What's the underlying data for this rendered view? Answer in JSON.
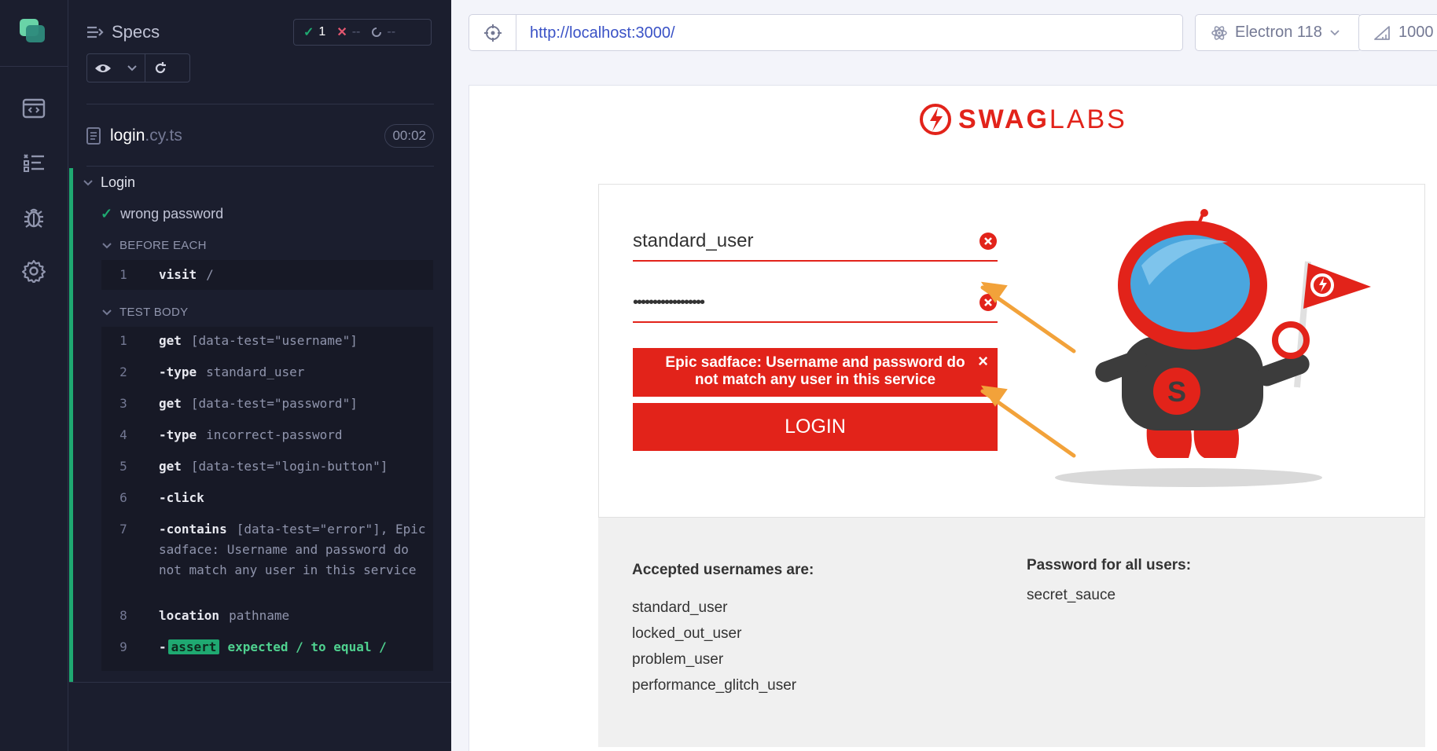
{
  "reporter": {
    "header_title": "Specs",
    "stats": {
      "passed": "1",
      "failed": "--",
      "pending": "--"
    },
    "spec_file": {
      "name": "login",
      "ext": ".cy.ts",
      "duration": "00:02"
    },
    "suite_title": "Login",
    "test_title": "wrong password",
    "before_each_label": "BEFORE EACH",
    "test_body_label": "TEST BODY",
    "before_each_commands": [
      {
        "num": "1",
        "name": "visit",
        "arg": "/"
      }
    ],
    "test_body_commands": [
      {
        "num": "1",
        "name": "get",
        "arg": "[data-test=\"username\"]"
      },
      {
        "num": "2",
        "name": "-type",
        "arg": "standard_user"
      },
      {
        "num": "3",
        "name": "get",
        "arg": "[data-test=\"password\"]"
      },
      {
        "num": "4",
        "name": "-type",
        "arg": "incorrect-password"
      },
      {
        "num": "5",
        "name": "get",
        "arg": "[data-test=\"login-button\"]"
      },
      {
        "num": "6",
        "name": "-click",
        "arg": ""
      },
      {
        "num": "7",
        "name": "-contains",
        "arg": "[data-test=\"error\"], Epic sadface: Username and password do not match any user in this service"
      },
      {
        "num": "8",
        "name": "location",
        "arg": "pathname"
      },
      {
        "num": "9",
        "name": "-",
        "badge": "assert",
        "arg": "expected / to equal /"
      }
    ]
  },
  "aut": {
    "url": "http://localhost:3000/",
    "browser": "Electron 118",
    "viewport": "1000"
  },
  "app": {
    "brand_bold": "SWAG",
    "brand_light": "LABS",
    "username_value": "standard_user",
    "password_value": "••••••••••••••••••",
    "error_message": "Epic sadface: Username and password do not match any user in this service",
    "error_close": "×",
    "login_label": "LOGIN",
    "usernames_heading": "Accepted usernames are:",
    "usernames": [
      "standard_user",
      "locked_out_user",
      "problem_user",
      "performance_glitch_user"
    ],
    "password_heading": "Password for all users:",
    "password_hint": "secret_sauce"
  },
  "colors": {
    "brand_red": "#e2231a",
    "pass_green": "#1fa971",
    "arrow_orange": "#f2a23a",
    "url_blue": "#3a52c6"
  },
  "icons": [
    "cypress-logo-icon",
    "browser-icon",
    "spec-list-icon",
    "debug-bug-icon",
    "settings-gear-icon",
    "eye-icon",
    "chevron-down-icon",
    "reload-icon",
    "check-icon",
    "x-icon",
    "spinner-icon",
    "file-icon",
    "crosshair-icon",
    "electron-icon",
    "ruler-icon",
    "error-circle-icon"
  ]
}
